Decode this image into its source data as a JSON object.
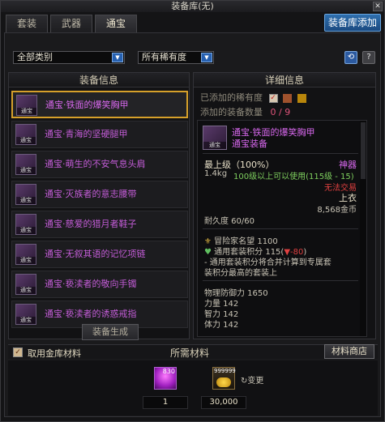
{
  "window": {
    "title": "装备库(无)",
    "close": "✕",
    "tabs": [
      "套装",
      "武器",
      "通宝"
    ],
    "stash_add": "装备库添加"
  },
  "filters": {
    "category": "全部类别",
    "rarity": "所有稀有度"
  },
  "left_panel": {
    "header": "装备信息",
    "items": [
      {
        "name": "通宝·铁面的爆笑胸甲",
        "icon_label": "通宝"
      },
      {
        "name": "通宝·青海的坚硬腿甲",
        "icon_label": "通宝"
      },
      {
        "name": "通宝·萌生的不安气息头肩",
        "icon_label": "通宝"
      },
      {
        "name": "通宝·灭族者的意志腰带",
        "icon_label": "通宝"
      },
      {
        "name": "通宝·慈爱的猎月者鞋子",
        "icon_label": "通宝"
      },
      {
        "name": "通宝·无叙其语的记忆项链",
        "icon_label": "通宝"
      },
      {
        "name": "通宝·亵渎者的敬向手镯",
        "icon_label": "通宝"
      },
      {
        "name": "通宝·亵渎者的诱惑戒指",
        "icon_label": "通宝"
      }
    ],
    "generate_button": "装备生成"
  },
  "right_panel": {
    "header": "详细信息",
    "added_rarity_label": "已添加的稀有度",
    "added_count_label": "添加的装备数量",
    "added_count_value": "0 / 9",
    "colors": {
      "box1": "#a0522d",
      "box2": "#b8860b"
    },
    "detail": {
      "icon_label": "通宝",
      "name": "通宝·铁面的爆笑胸甲",
      "subtitle": "通宝装备",
      "max_level": "最上级（100%）",
      "grade": "神器",
      "weight": "1.4kg",
      "level_req": "100级以上可以使用(115级 - 15)",
      "untradable": "无法交易",
      "slot": "上衣",
      "price": "8,568金币",
      "durability": "耐久度 60/60",
      "adventure_fame": "冒险家名望 1100",
      "set_points_label": "通用套装积分 115(",
      "set_points_delta": "-80",
      "set_points_end": ")",
      "set_note_1": "- 通用套装积分将合并计算到专属套",
      "set_note_2": "装积分最高的套装上",
      "phys_def": "物理防御力 1650",
      "str": "力量 142",
      "int": "智力 142",
      "vit": "体力 142"
    }
  },
  "materials": {
    "use_stash_label": "取用金库材料",
    "title": "所需材料",
    "shop_button": "材料商店",
    "item1_count": "830",
    "item2_count": "999999",
    "change_link": "↻变更",
    "qty1": "1",
    "qty2": "30,000"
  }
}
